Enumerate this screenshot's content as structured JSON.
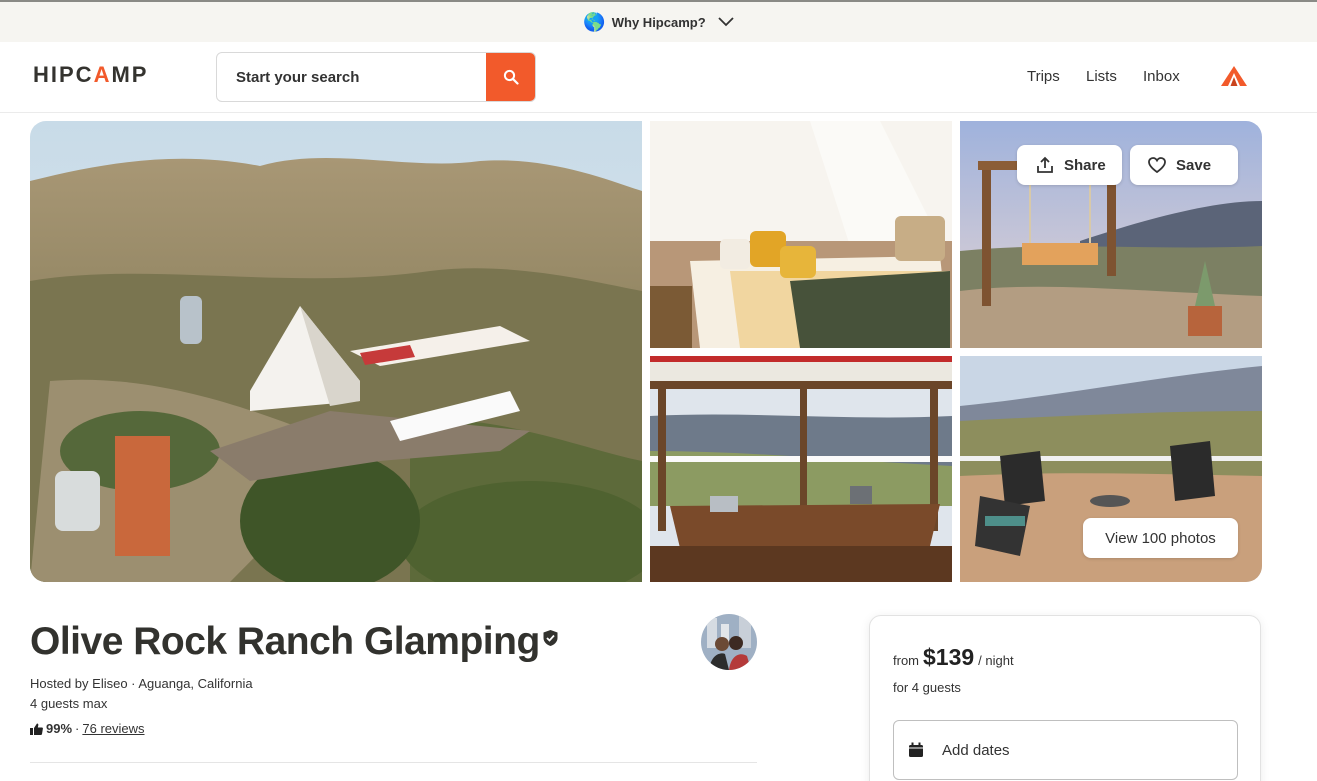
{
  "banner": {
    "globe": "🌎",
    "label": "Why Hipcamp?",
    "icon": "chevron-down-icon"
  },
  "brand": {
    "logo_pre": "HIPC",
    "logo_tri": "A",
    "logo_post": "MP",
    "accent": "#f25a2b"
  },
  "search": {
    "placeholder": "Start your search",
    "icon": "search-icon"
  },
  "nav": {
    "trips": "Trips",
    "lists": "Lists",
    "inbox": "Inbox"
  },
  "gallery": {
    "photos": [
      {
        "name": "main-photo",
        "alt": "Aerial view of bell tent glamping site on hillside"
      },
      {
        "name": "tent-interior-photo",
        "alt": "Bell tent interior with bed and yellow pillows"
      },
      {
        "name": "swing-photo",
        "alt": "Wooden swing overlooking mountains"
      },
      {
        "name": "picnic-table-photo",
        "alt": "Picnic table under pergola with valley view"
      },
      {
        "name": "patio-photo",
        "alt": "Patio chairs around fire pit with valley view"
      }
    ],
    "share_label": "Share",
    "save_label": "Save",
    "view_photos_label": "View 100 photos"
  },
  "listing": {
    "title": "Olive Rock Ranch Glamping",
    "host_location": "Hosted by Eliseo · Aguanga, California",
    "guests_max": "4 guests max",
    "rating": "99%",
    "separator": "·",
    "reviews": "76 reviews"
  },
  "booking": {
    "from_label": "from",
    "price": "$139",
    "per_night": "/ night",
    "for_guests": "for 4 guests",
    "add_dates": "Add dates"
  }
}
